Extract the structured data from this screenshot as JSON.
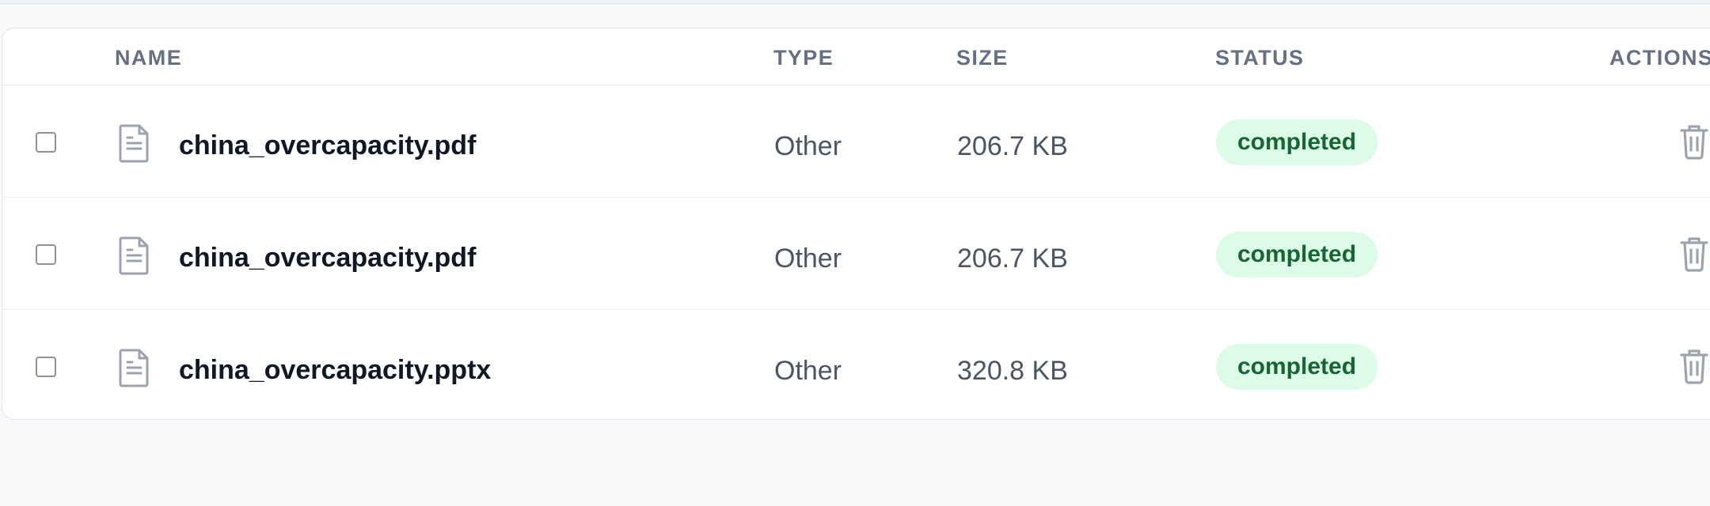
{
  "table": {
    "headers": {
      "name": "NAME",
      "type": "TYPE",
      "size": "SIZE",
      "status": "STATUS",
      "actions": "ACTIONS"
    },
    "rows": [
      {
        "name": "china_overcapacity.pdf",
        "type": "Other",
        "size": "206.7 KB",
        "status": "completed",
        "icon": "file-text-icon",
        "action_icon": "trash-icon"
      },
      {
        "name": "china_overcapacity.pdf",
        "type": "Other",
        "size": "206.7 KB",
        "status": "completed",
        "icon": "file-text-icon",
        "action_icon": "trash-icon"
      },
      {
        "name": "china_overcapacity.pptx",
        "type": "Other",
        "size": "320.8 KB",
        "status": "completed",
        "icon": "file-text-icon",
        "action_icon": "trash-icon"
      }
    ]
  },
  "colors": {
    "background": "#f8f9fb",
    "card": "#ffffff",
    "border": "#e1e5ec",
    "header_text": "#667085",
    "primary_text": "#101828",
    "secondary_text": "#4b5563",
    "status_background": "#dcfce7",
    "status_text": "#166534",
    "icon": "#9ca3af"
  }
}
